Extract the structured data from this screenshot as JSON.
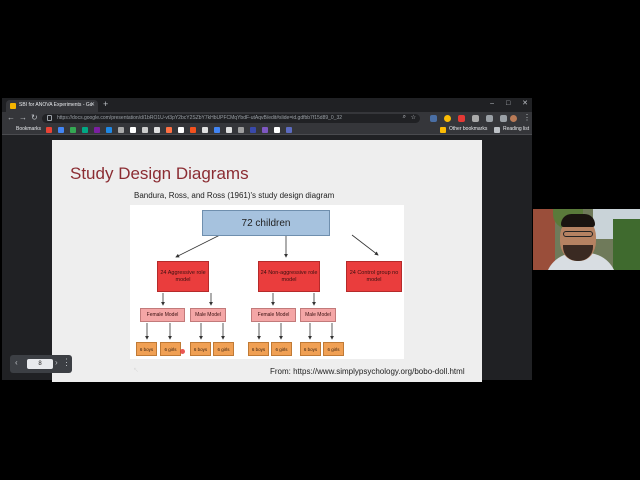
{
  "browser": {
    "tab_title": "SBI for ANOVA Experiments - Go",
    "url": "https://docs.google.com/presentation/d/1bRO1U-vt3pY2bcY2SZbY7kHbUPFCMqYbdF-utAqvB/edit#slide=id.gdfbb7f15d89_0_32",
    "bookmarks_label": "Bookmarks",
    "other_bookmarks_label": "Other bookmarks",
    "reading_list_label": "Reading list"
  },
  "slide": {
    "title": "Study Design Diagrams",
    "subtitle": "Bandura, Ross, and Ross (1961)'s study design diagram",
    "source": "From: https://www.simplypsychology.org/bobo-doll.html"
  },
  "diagram": {
    "root": "72 children",
    "groups": [
      "24 Aggressive role model",
      "24 Non-aggressive role model",
      "24 Control group no model"
    ],
    "models": [
      "Female Model",
      "Male Model",
      "Female Model",
      "Male Model"
    ],
    "leaves": [
      "6 boys",
      "6 girls",
      "6 boys",
      "6 girls",
      "6 boys",
      "6 girls",
      "6 boys",
      "6 girls"
    ]
  },
  "navigator": {
    "slide_number": "8"
  },
  "colors": {
    "title": "#8b2c32",
    "root_box": "#a6c2de",
    "group_box": "#ea3d3d",
    "model_box": "#f4a6a6",
    "leaf_box": "#f0a054"
  }
}
